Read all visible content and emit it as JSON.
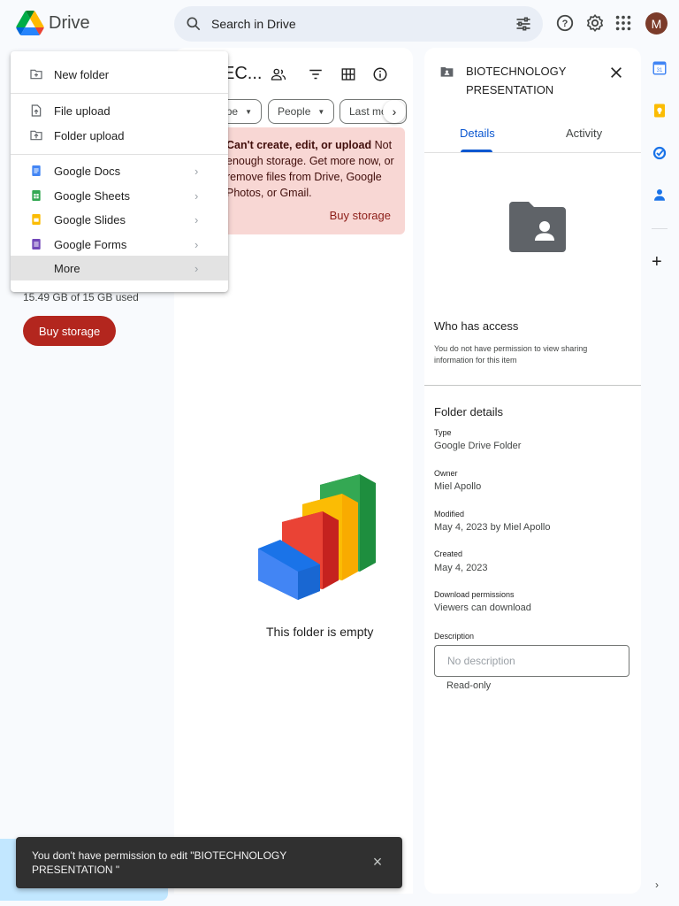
{
  "app": {
    "name": "Drive",
    "avatar_initial": "M"
  },
  "search": {
    "placeholder": "Search in Drive"
  },
  "storage": {
    "used_text": "15.49 GB of 15 GB used",
    "buy_label": "Buy storage"
  },
  "new_menu": {
    "items": [
      {
        "label": "New folder",
        "icon": "new-folder-icon"
      },
      {
        "label": "File upload",
        "icon": "file-upload-icon"
      },
      {
        "label": "Folder upload",
        "icon": "folder-upload-icon"
      },
      {
        "label": "Google Docs",
        "icon": "docs-icon",
        "color": "#4285f4"
      },
      {
        "label": "Google Sheets",
        "icon": "sheets-icon",
        "color": "#34a853"
      },
      {
        "label": "Google Slides",
        "icon": "slides-icon",
        "color": "#fbbc04"
      },
      {
        "label": "Google Forms",
        "icon": "forms-icon",
        "color": "#7248b9"
      },
      {
        "label": "More",
        "icon": ""
      }
    ],
    "chevron": "›"
  },
  "folder": {
    "title_truncated": "EC...",
    "chips": [
      "pe",
      "People",
      "Last mo"
    ],
    "alert": {
      "bold": "Can't create, edit, or upload",
      "text": " Not enough storage. Get more now, or remove files from Drive, Google Photos, or Gmail.",
      "action": "Buy storage"
    },
    "empty_text": "This folder is empty"
  },
  "details": {
    "title": "BIOTECHNOLOGY PRESENTATION",
    "tabs": [
      "Details",
      "Activity"
    ],
    "who_has_access": {
      "heading": "Who has access",
      "text": "You do not have permission to view sharing information for this item"
    },
    "folder_details": {
      "heading": "Folder details",
      "type_label": "Type",
      "type_value": "Google Drive Folder",
      "owner_label": "Owner",
      "owner_value": "Miel Apollo",
      "modified_label": "Modified",
      "modified_value": "May 4, 2023 by Miel Apollo",
      "created_label": "Created",
      "created_value": "May 4, 2023",
      "download_label": "Download permissions",
      "download_value": "Viewers can download",
      "description_label": "Description",
      "description_placeholder": "No description",
      "readonly": "Read-only"
    }
  },
  "snackbar": {
    "text": "You don't have permission to edit \"BIOTECHNOLOGY PRESENTATION \"",
    "close": "×"
  },
  "colors": {
    "accent": "#0b57d0",
    "danger": "#b3261e",
    "alert_bg": "#f8d7d4"
  }
}
